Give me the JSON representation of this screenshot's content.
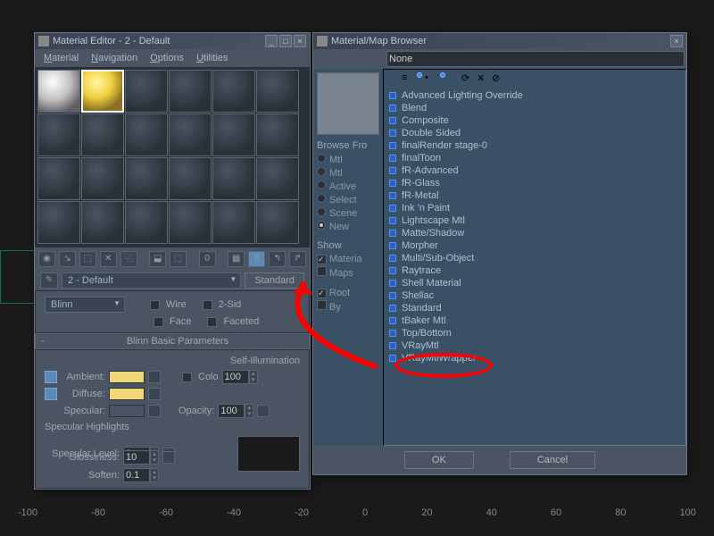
{
  "material_editor": {
    "title": "Material Editor - 2 - Default",
    "menu": [
      "Material",
      "Navigation",
      "Options",
      "Utilities"
    ],
    "slot_selected": 1,
    "name_field": "2 - Default",
    "type_button": "Standard",
    "shader": "Blinn",
    "shader_opts": {
      "wire": "Wire",
      "face": "Face",
      "two_sided": "2-Sid",
      "faceted": "Faceted"
    },
    "rollout_title": "Blinn Basic Parameters",
    "self_illum_label": "Self-Illumination",
    "colo_label": "Colo",
    "colo_value": "100",
    "ambient_label": "Ambient:",
    "diffuse_label": "Diffuse:",
    "specular_label": "Specular:",
    "opacity_label": "Opacity:",
    "opacity_value": "100",
    "highlights_label": "Specular Highlights",
    "spec_level_label": "Specular Level:",
    "spec_level_value": "0",
    "gloss_label": "Glossiness:",
    "gloss_value": "10",
    "soften_label": "Soften:",
    "soften_value": "0.1",
    "colors": {
      "ambient": "#f0d878",
      "diffuse": "#f0d878",
      "specular": "#4a5463"
    }
  },
  "browser": {
    "title": "Material/Map Browser",
    "search_value": "None",
    "browse_from_label": "Browse Fro",
    "browse_options": [
      "Mtl",
      "Mtl",
      "Active",
      "Select",
      "Scene",
      "New"
    ],
    "browse_selected": 5,
    "show_label": "Show",
    "show_options": [
      "Materia",
      "Maps"
    ],
    "root_label": "Root",
    "by_label": "By",
    "materials": [
      "Advanced Lighting Override",
      "Blend",
      "Composite",
      "Double Sided",
      "finalRender stage-0",
      "finalToon",
      "fR-Advanced",
      "fR-Glass",
      "fR-Metal",
      "Ink 'n Paint",
      "Lightscape Mtl",
      "Matte/Shadow",
      "Morpher",
      "Multi/Sub-Object",
      "Raytrace",
      "Shell Material",
      "Shellac",
      "Standard",
      "tBaker Mtl",
      "Top/Bottom",
      "VRayMtl",
      "VRayMtlWrapper"
    ],
    "ok": "OK",
    "cancel": "Cancel"
  },
  "ruler_ticks": [
    "-100",
    "-80",
    "-60",
    "-40",
    "-20",
    "0",
    "20",
    "40",
    "60",
    "80",
    "100"
  ]
}
